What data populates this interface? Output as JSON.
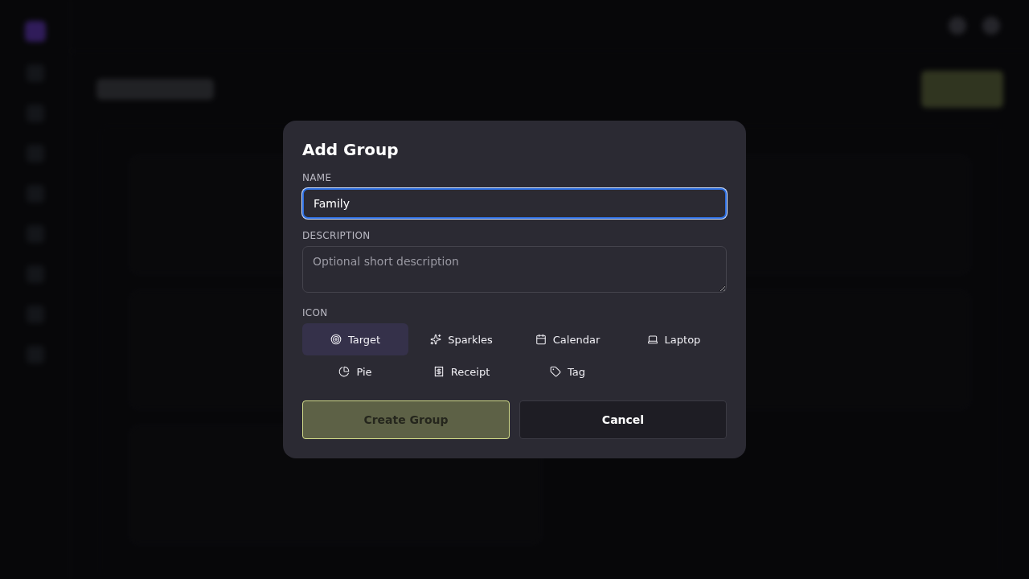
{
  "dialog": {
    "title": "Add Group",
    "name_field": {
      "label": "NAME",
      "value": "Family",
      "focused": true
    },
    "description_field": {
      "label": "DESCRIPTION",
      "placeholder": "Optional short description"
    },
    "icon_label": "ICON",
    "icon_options": [
      {
        "label": "Target",
        "selected": true
      },
      {
        "label": "Sparkles",
        "selected": false
      },
      {
        "label": "Calendar",
        "selected": false
      },
      {
        "label": "Laptop",
        "selected": false
      },
      {
        "label": "Pie",
        "selected": false
      },
      {
        "label": "Receipt",
        "selected": false
      },
      {
        "label": "Tag",
        "selected": false
      }
    ],
    "buttons": [
      {
        "label": "Create Group",
        "kind": "primary"
      },
      {
        "label": "Cancel",
        "kind": "secondary"
      }
    ]
  }
}
